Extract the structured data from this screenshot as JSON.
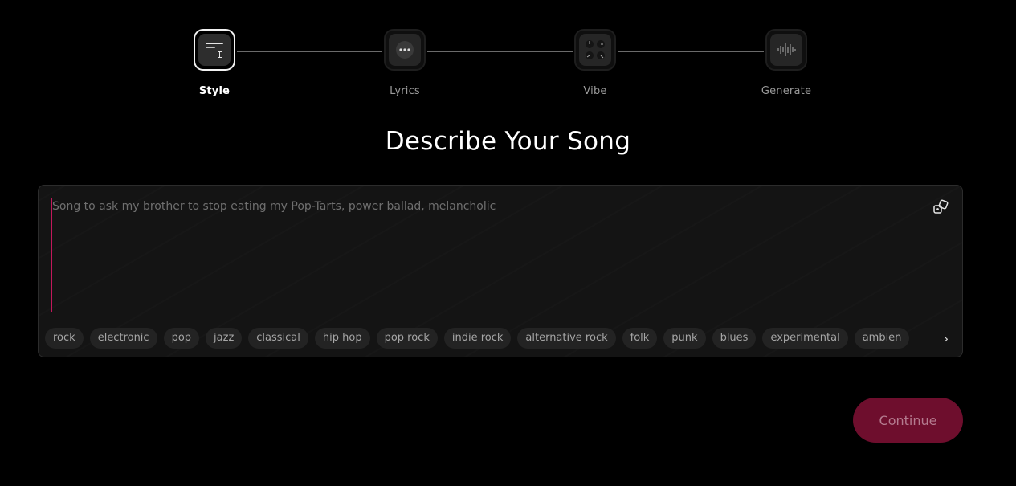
{
  "stepper": {
    "steps": [
      {
        "label": "Style",
        "active": true
      },
      {
        "label": "Lyrics",
        "active": false
      },
      {
        "label": "Vibe",
        "active": false
      },
      {
        "label": "Generate",
        "active": false
      }
    ]
  },
  "heading": "Describe Your Song",
  "prompt": {
    "value": "",
    "placeholder": "Song to ask my brother to stop eating my Pop-Tarts, power ballad, melancholic"
  },
  "chips": [
    "rock",
    "electronic",
    "pop",
    "jazz",
    "classical",
    "hip hop",
    "pop rock",
    "indie rock",
    "alternative rock",
    "folk",
    "punk",
    "blues",
    "experimental",
    "ambien"
  ],
  "continue_label": "Continue",
  "colors": {
    "accent": "#6e0e2d",
    "background": "#000000",
    "box_background": "#141414"
  }
}
